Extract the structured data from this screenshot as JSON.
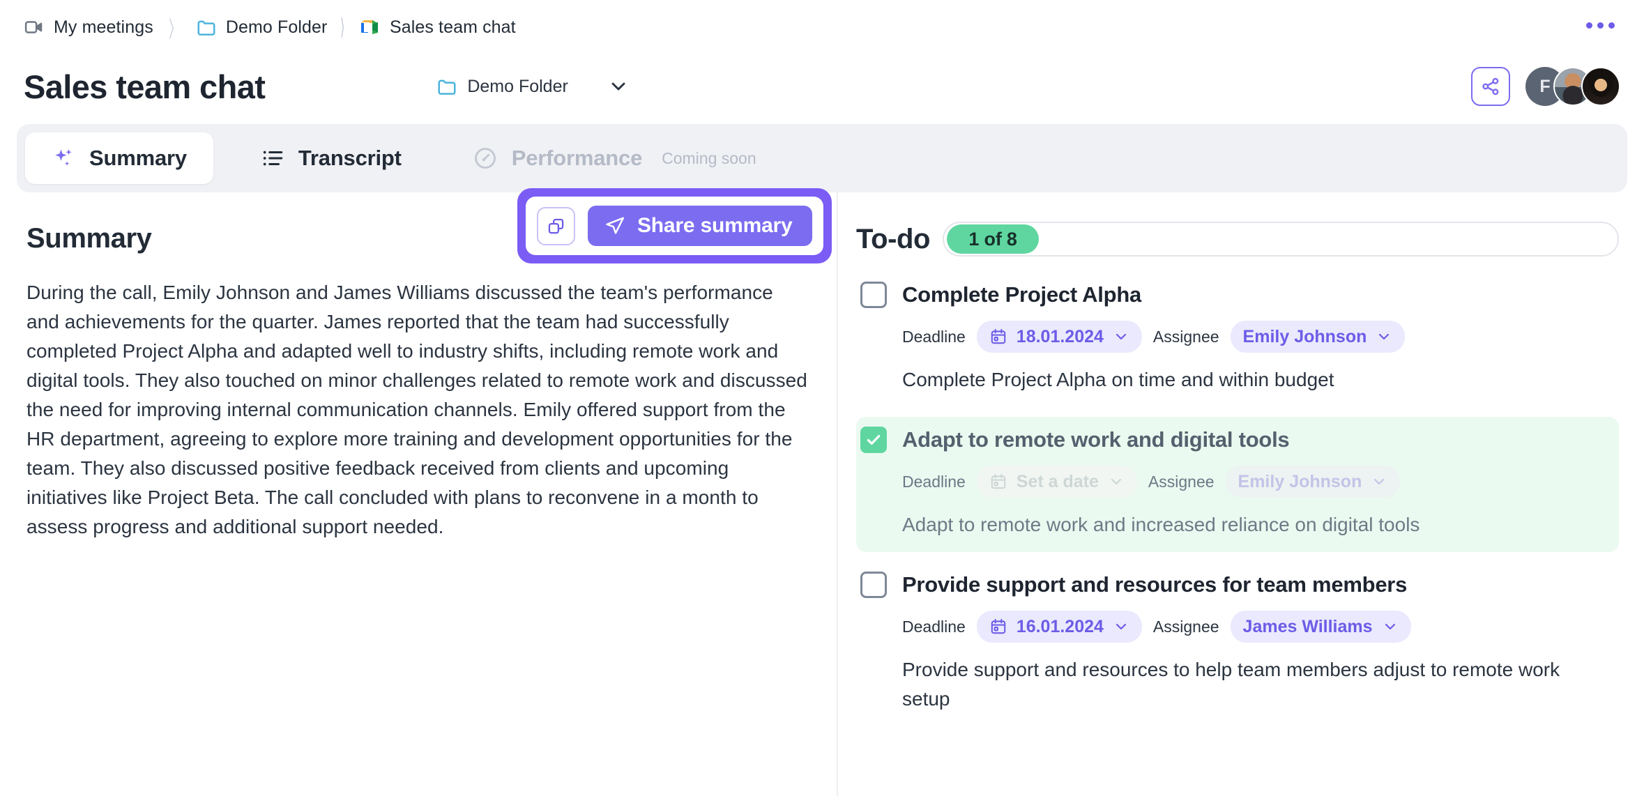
{
  "breadcrumb": {
    "items": [
      {
        "label": "My meetings",
        "icon": "video-camera-icon"
      },
      {
        "label": "Demo Folder",
        "icon": "folder-icon"
      },
      {
        "label": "Sales team chat",
        "icon": "google-meet-icon"
      }
    ],
    "separator": "〉"
  },
  "header": {
    "title": "Sales team chat",
    "folder_label": "Demo Folder",
    "folder_icon": "folder-icon",
    "folder_chevron": "chevron-down-icon",
    "share_icon": "share-nodes-icon",
    "overflow_icon": "ellipsis-icon",
    "avatars": [
      {
        "type": "initial",
        "label": "F"
      },
      {
        "type": "photo",
        "label": ""
      },
      {
        "type": "photo",
        "label": ""
      }
    ]
  },
  "tabs": [
    {
      "label": "Summary",
      "icon": "sparkle-icon",
      "active": true,
      "disabled": false,
      "note": ""
    },
    {
      "label": "Transcript",
      "icon": "list-icon",
      "active": false,
      "disabled": false,
      "note": ""
    },
    {
      "label": "Performance",
      "icon": "gauge-icon",
      "active": false,
      "disabled": true,
      "note": "Coming soon"
    }
  ],
  "summary": {
    "heading": "Summary",
    "body": "During the call, Emily Johnson and James Williams discussed the team's performance and achievements for the quarter. James reported that the team had successfully completed Project Alpha and adapted well to industry shifts, including remote work and digital tools. They also touched on minor challenges related to remote work and discussed the need for improving internal communication channels. Emily offered support from the HR department, agreeing to explore more training and development opportunities for the team. They also discussed positive feedback received from clients and upcoming initiatives like Project Beta. The call concluded with plans to reconvene in a month to assess progress and additional support needed.",
    "copy_icon": "copy-icon",
    "share_label": "Share summary",
    "share_icon": "paper-plane-icon"
  },
  "todo": {
    "heading": "To-do",
    "progress_label": "1 of 8",
    "deadline_label": "Deadline",
    "assignee_label": "Assignee",
    "calendar_icon": "calendar-icon",
    "chevron_icon": "chevron-down-icon",
    "items": [
      {
        "title": "Complete Project Alpha",
        "done": false,
        "deadline": "18.01.2024",
        "assignee": "Emily Johnson",
        "description": "Complete Project Alpha on time and within budget"
      },
      {
        "title": "Adapt to remote work and digital tools",
        "done": true,
        "deadline": "Set a date",
        "assignee": "Emily Johnson",
        "description": "Adapt to remote work and increased reliance on digital tools"
      },
      {
        "title": "Provide support and resources for team members",
        "done": false,
        "deadline": "16.01.2024",
        "assignee": "James Williams",
        "description": "Provide support and resources to help team members adjust to remote work setup"
      }
    ]
  },
  "colors": {
    "accent_purple": "#7b6cf0",
    "highlight_purple": "#7b5cf5",
    "success_green": "#5fd6a0",
    "done_bg": "#eafaf0",
    "tabbar_bg": "#f0f1f5",
    "folder_blue": "#4bb4dd"
  }
}
